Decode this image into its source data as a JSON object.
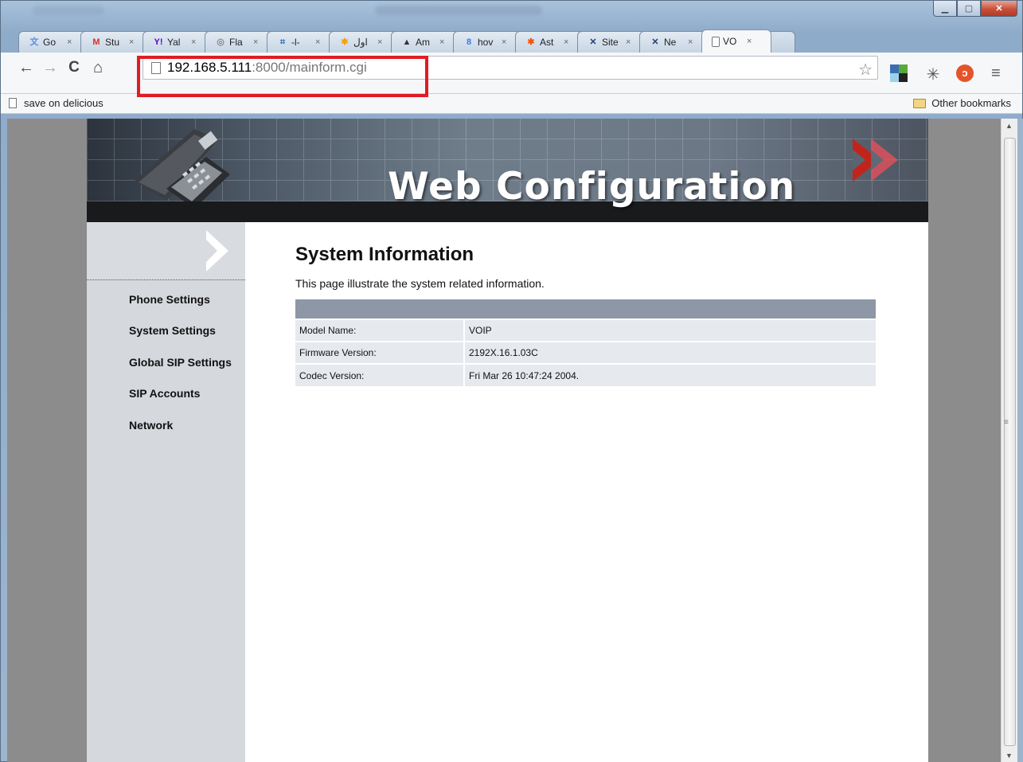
{
  "browser": {
    "tabs": [
      {
        "label": "Go",
        "favicon": "translate-icon",
        "color": "#5a8fd6",
        "glyph": "文"
      },
      {
        "label": "Stu",
        "favicon": "gmail-icon",
        "color": "#d93025",
        "glyph": "M"
      },
      {
        "label": "Yal",
        "favicon": "yahoo-icon",
        "color": "#5f01d1",
        "glyph": "Y!"
      },
      {
        "label": "Fla",
        "favicon": "flash-icon",
        "color": "#888888",
        "glyph": "◎"
      },
      {
        "label": "-l-",
        "favicon": "tool-icon",
        "color": "#2e6fb0",
        "glyph": "⌗"
      },
      {
        "label": "اول",
        "favicon": "asterisk-icon",
        "color": "#f2a20c",
        "glyph": "✱"
      },
      {
        "label": "Am",
        "favicon": "linux-icon",
        "color": "#333333",
        "glyph": "▲"
      },
      {
        "label": "hov",
        "favicon": "google-icon",
        "color": "#3b78e7",
        "glyph": "8"
      },
      {
        "label": "Ast",
        "favicon": "asterisk-icon",
        "color": "#f2560c",
        "glyph": "✱"
      },
      {
        "label": "Site",
        "favicon": "site-icon",
        "color": "#1f3f78",
        "glyph": "✕"
      },
      {
        "label": "Ne",
        "favicon": "site-icon",
        "color": "#1f3f78",
        "glyph": "✕"
      },
      {
        "label": "VO",
        "favicon": "page-icon",
        "color": "#555555",
        "glyph": "",
        "active": true
      }
    ],
    "tab_close": "×",
    "url_host": "192.168.5.111",
    "url_rest": ":8000/mainform.cgi",
    "bookmark_left": "save on delicious",
    "bookmark_right": "Other bookmarks"
  },
  "page": {
    "banner_title": "Web Configuration",
    "sidebar": {
      "items": [
        {
          "label": "Phone Settings"
        },
        {
          "label": "System Settings"
        },
        {
          "label": "Global SIP Settings"
        },
        {
          "label": "SIP Accounts"
        },
        {
          "label": "Network"
        }
      ]
    },
    "heading": "System Information",
    "description": "This page illustrate the system related information.",
    "table": {
      "rows": [
        {
          "label": "Model Name:",
          "value": "VOIP"
        },
        {
          "label": "Firmware Version:",
          "value": "2192X.16.1.03C"
        },
        {
          "label": "Codec Version:",
          "value": "Fri Mar 26 10:47:24 2004."
        }
      ]
    }
  }
}
